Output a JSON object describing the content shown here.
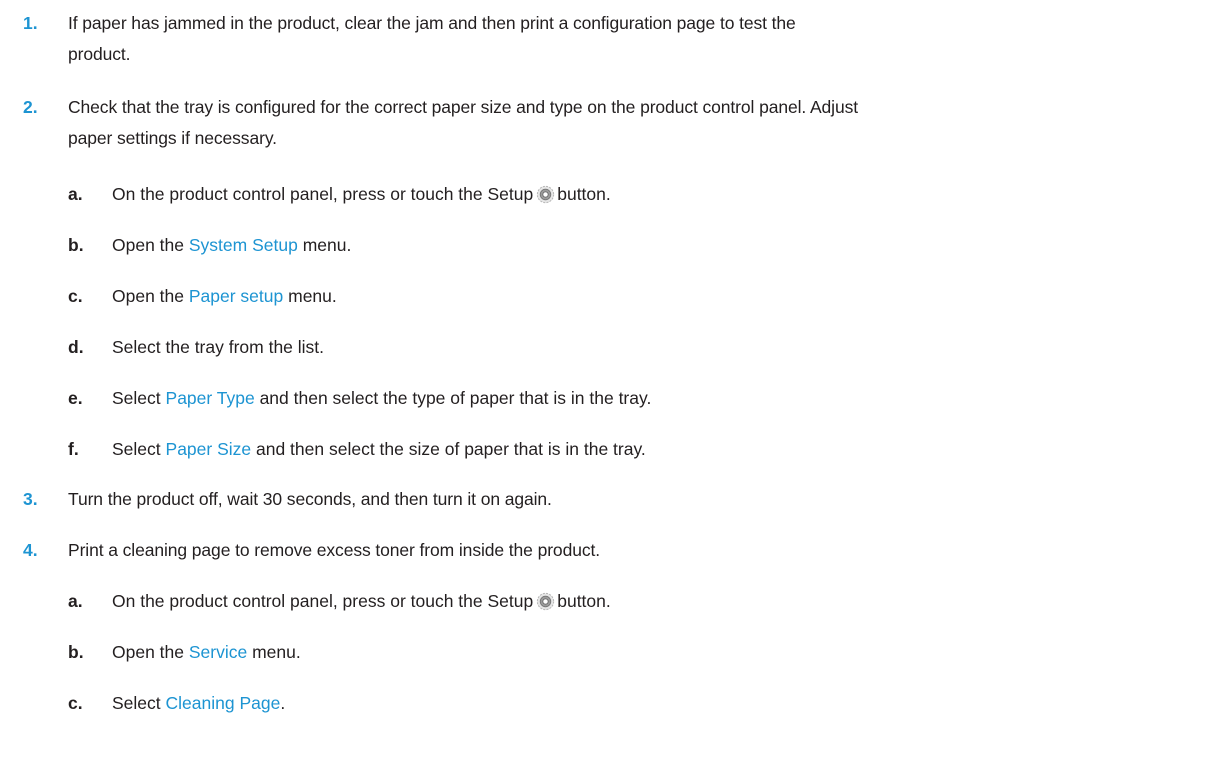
{
  "steps": [
    {
      "number": "1.",
      "line1": "If paper has jammed in the product, clear the jam and then print a configuration page to test the",
      "line2": "product."
    },
    {
      "number": "2.",
      "line1": "Check that the tray is configured for the correct paper size and type on the product control panel. Adjust",
      "line2": "paper settings if necessary.",
      "substeps": [
        {
          "letter": "a.",
          "pre": "On the product control panel, press or touch the Setup",
          "icon": "gear-icon",
          "post": "button."
        },
        {
          "letter": "b.",
          "pre": "Open the",
          "link": "System Setup",
          "post": "menu."
        },
        {
          "letter": "c.",
          "pre": "Open the",
          "link": "Paper setup",
          "post": "menu."
        },
        {
          "letter": "d.",
          "text": "Select the tray from the list."
        },
        {
          "letter": "e.",
          "pre": "Select",
          "link": "Paper Type",
          "post": "and then select the type of paper that is in the tray."
        },
        {
          "letter": "f.",
          "pre": "Select",
          "link": "Paper Size",
          "post": "and then select the size of paper that is in the tray."
        }
      ]
    },
    {
      "number": "3.",
      "line1": "Turn the product off, wait 30 seconds, and then turn it on again."
    },
    {
      "number": "4.",
      "line1": "Print a cleaning page to remove excess toner from inside the product.",
      "substeps": [
        {
          "letter": "a.",
          "pre": "On the product control panel, press or touch the Setup",
          "icon": "gear-icon",
          "post": "button."
        },
        {
          "letter": "b.",
          "pre": "Open the",
          "link": "Service",
          "post": "menu."
        },
        {
          "letter": "c.",
          "pre": "Select",
          "link": "Cleaning Page",
          "post": "."
        }
      ]
    }
  ],
  "colors": {
    "accent": "#1d94d2",
    "text": "#231f20"
  }
}
